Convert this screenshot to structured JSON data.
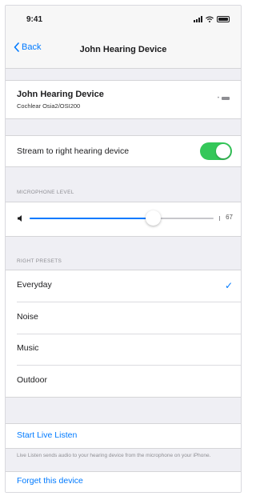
{
  "status_bar": {
    "time": "9:41"
  },
  "nav": {
    "back_label": "Back",
    "title": "John Hearing Device"
  },
  "device": {
    "name": "John Hearing Device",
    "model": "Cochlear Osia2/OSI200"
  },
  "stream": {
    "label": "Stream to right hearing device",
    "enabled": true
  },
  "microphone": {
    "header": "MICROPHONE LEVEL",
    "value": "67",
    "level_fraction": 0.67
  },
  "presets": {
    "header": "RIGHT PRESETS",
    "items": [
      {
        "label": "Everyday",
        "selected": true
      },
      {
        "label": "Noise",
        "selected": false
      },
      {
        "label": "Music",
        "selected": false
      },
      {
        "label": "Outdoor",
        "selected": false
      }
    ],
    "check_mark": "✓"
  },
  "live_listen": {
    "label": "Start Live Listen",
    "description": "Live Listen sends audio to your hearing device from the microphone on your iPhone."
  },
  "forget": {
    "label": "Forget this device"
  },
  "colors": {
    "accent": "#007aff",
    "toggle_on": "#34c759"
  }
}
